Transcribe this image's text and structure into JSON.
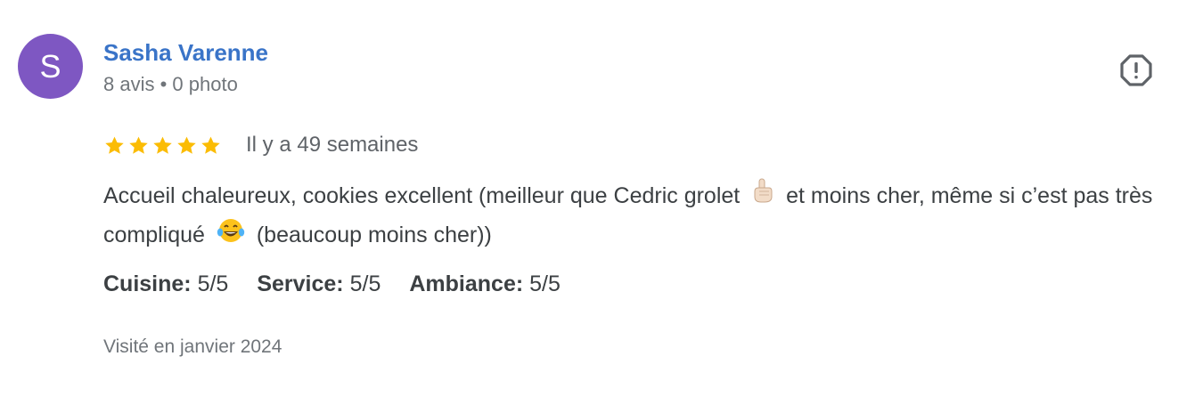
{
  "review": {
    "author": {
      "initial": "S",
      "name": "Sasha Varenne",
      "meta": "8 avis • 0 photo",
      "avatar_color": "#7e57c2"
    },
    "rating": {
      "stars": 5,
      "max": 5,
      "date": "Il y a 49 semaines"
    },
    "text": {
      "part1": "Accueil chaleureux, cookies excellent (meilleur que Cedric grolet",
      "emoji1": "pointing-up-hand",
      "part2": "et moins cher, même si c’est pas très compliqué",
      "emoji2": "tears-of-joy-face",
      "part3": "(beaucoup moins cher))"
    },
    "scores": [
      {
        "label": "Cuisine:",
        "value": "5/5"
      },
      {
        "label": "Service:",
        "value": "5/5"
      },
      {
        "label": "Ambiance:",
        "value": "5/5"
      }
    ],
    "visited": "Visité en janvier 2024",
    "report_icon": "report-flag-icon"
  },
  "colors": {
    "name_link": "#3a74c8",
    "star": "#fbbc04",
    "muted_text": "#70757a",
    "body_text": "#3c4043"
  }
}
